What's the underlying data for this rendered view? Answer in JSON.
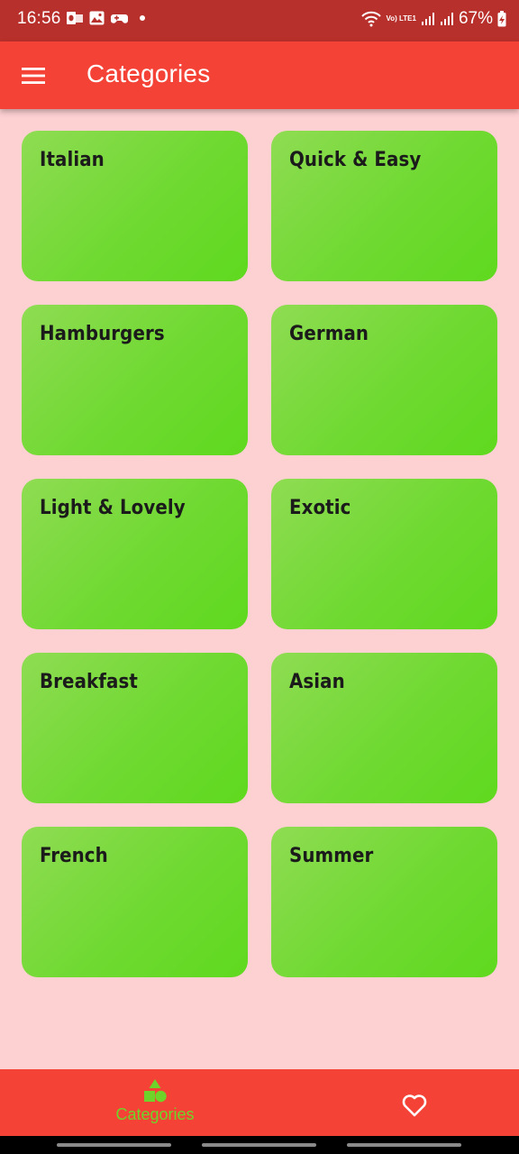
{
  "status_bar": {
    "time": "16:56",
    "battery": "67%",
    "network_label": "Vo) LTE1"
  },
  "app_bar": {
    "title": "Categories",
    "menu_icon": "hamburger-menu-icon"
  },
  "categories": [
    {
      "label": "Italian"
    },
    {
      "label": "Quick & Easy"
    },
    {
      "label": "Hamburgers"
    },
    {
      "label": "German"
    },
    {
      "label": "Light & Lovely"
    },
    {
      "label": "Exotic"
    },
    {
      "label": "Breakfast"
    },
    {
      "label": "Asian"
    },
    {
      "label": "French"
    },
    {
      "label": "Summer"
    }
  ],
  "bottom_nav": {
    "categories_label": "Categories",
    "categories_icon": "shapes-icon",
    "favorites_icon": "heart-outline-icon",
    "active_color": "#6fd42a"
  },
  "colors": {
    "app_bar": "#f44336",
    "status_bar": "#b8302c",
    "background": "#fdd0d2",
    "card_gradient_start": "#8fdc53",
    "card_gradient_end": "#5fd91f"
  }
}
